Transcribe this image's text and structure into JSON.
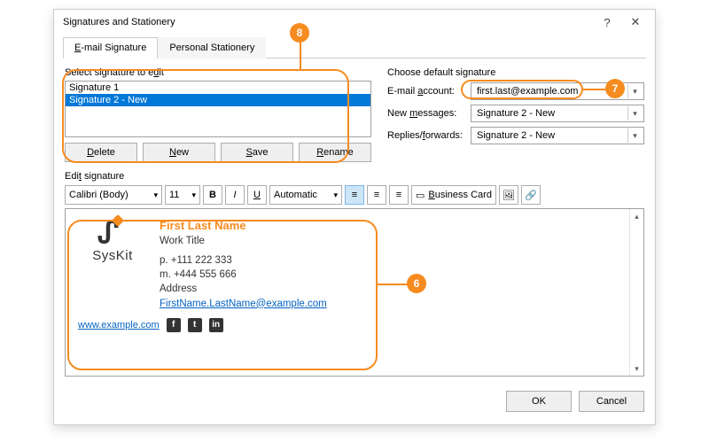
{
  "titlebar": {
    "title": "Signatures and Stationery"
  },
  "tabs": {
    "email": "E-mail Signature",
    "stationery": "Personal Stationery"
  },
  "left": {
    "select_label": "Select signature to edit",
    "signatures": [
      "Signature 1",
      "Signature 2 - New"
    ],
    "selected_index": 1,
    "buttons": {
      "delete": "Delete",
      "new": "New",
      "save": "Save",
      "rename": "Rename"
    }
  },
  "right": {
    "section": "Choose default signature",
    "account_label": "E-mail account:",
    "account_value": "first.last@example.com",
    "newmsg_label": "New messages:",
    "newmsg_value": "Signature 2 - New",
    "reply_label": "Replies/forwards:",
    "reply_value": "Signature 2 - New"
  },
  "editor": {
    "label": "Edit signature",
    "font": "Calibri (Body)",
    "size": "11",
    "color": "Automatic",
    "bizcard": "Business Card"
  },
  "signature": {
    "brand": "SysKit",
    "name": "First Last Name",
    "title": "Work Title",
    "phone": "p.  +111 222 333",
    "mobile": "m. +444 555 666",
    "address": "Address",
    "email": "FirstName.LastName@example.com",
    "web": "www.example.com"
  },
  "footer": {
    "ok": "OK",
    "cancel": "Cancel"
  },
  "callouts": {
    "c6": "6",
    "c7": "7",
    "c8": "8"
  }
}
